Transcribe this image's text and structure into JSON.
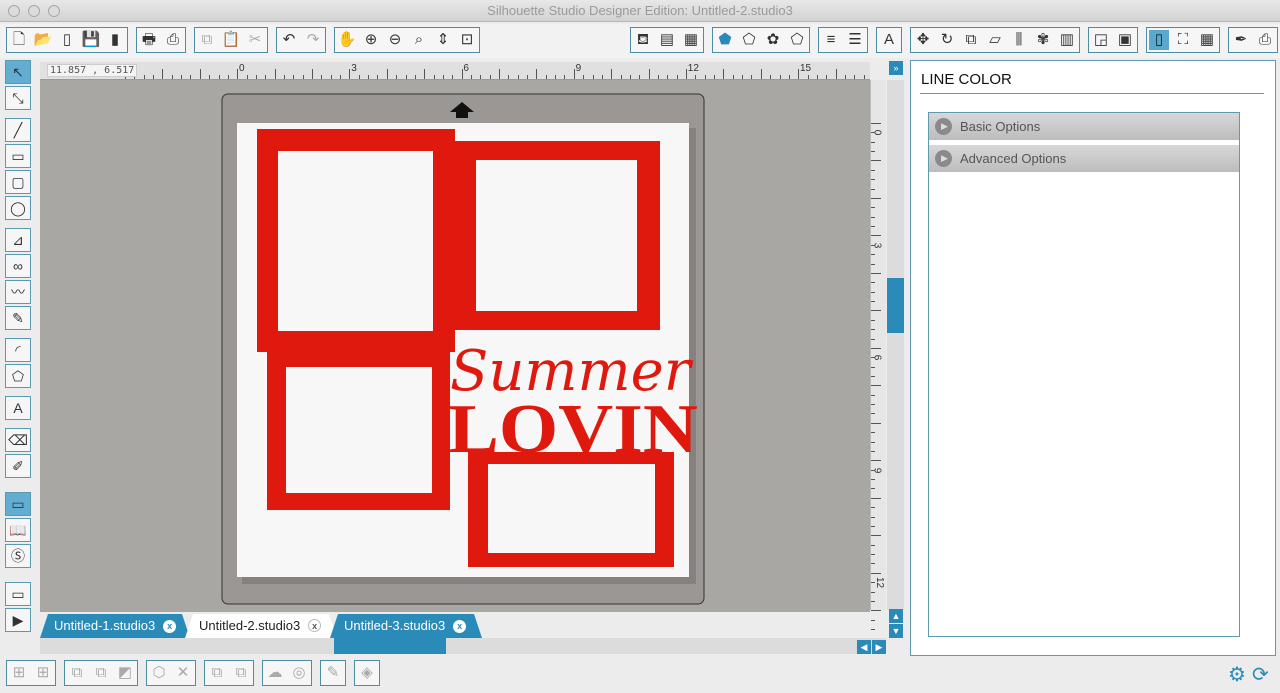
{
  "window": {
    "title": "Silhouette Studio Designer Edition: Untitled-2.studio3"
  },
  "toolbar": {
    "groups": [
      [
        "new-document-icon",
        "open-icon",
        "page-setup-icon",
        "save-icon",
        "save-to-sd-icon"
      ],
      [
        "print-icon",
        "send-to-silhouette-icon"
      ],
      [
        "copy-icon",
        "paste-icon",
        "cut-icon"
      ],
      [
        "undo-icon",
        "redo-icon"
      ],
      [
        "pan-icon",
        "zoom-in-icon",
        "zoom-out-icon",
        "zoom-select-icon",
        "drag-zoom-icon",
        "fit-to-page-icon"
      ],
      [
        "fill-color-icon",
        "fill-gradient-icon",
        "fill-pattern-icon"
      ],
      [
        "line-color-icon",
        "line-style-icon",
        "shadow-icon",
        "sketch-icon"
      ],
      [
        "line-color-bars-icon",
        "line-style-bars-icon"
      ],
      [
        "text-style-icon"
      ],
      [
        "transform-icon",
        "rotate-icon",
        "scale-icon",
        "shear-icon",
        "align-icon",
        "replicate-icon",
        "nest-icon"
      ],
      [
        "library-icon",
        "trace-icon"
      ],
      [
        "page-setup-panel-icon",
        "registration-marks-icon",
        "grid-icon"
      ],
      [
        "cut-settings-icon",
        "send-icon"
      ]
    ]
  },
  "coords": "11.857 , 6.517",
  "ruler": {
    "h": [
      "3",
      "0",
      "3",
      "6",
      "9",
      "12",
      "15"
    ],
    "v": [
      "0",
      "3",
      "6",
      "9",
      "12"
    ]
  },
  "artwork": {
    "line1": "Summer",
    "line2": "LOVIN",
    "color": "#e0190f"
  },
  "panel": {
    "title": "LINE COLOR",
    "sections": [
      "Basic Options",
      "Advanced Options"
    ]
  },
  "tabs": [
    {
      "label": "Untitled-1.studio3",
      "active": false
    },
    {
      "label": "Untitled-2.studio3",
      "active": true
    },
    {
      "label": "Untitled-3.studio3",
      "active": false
    }
  ],
  "accent": "#2a8ab8"
}
